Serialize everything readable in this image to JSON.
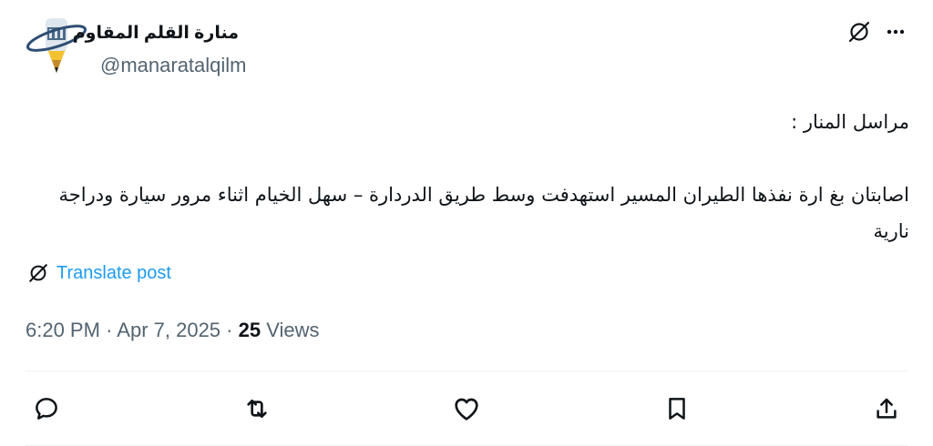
{
  "author": {
    "display_name": "منارة القلم المقاوم",
    "handle": "@manaratalqilm"
  },
  "tweet": {
    "lines": [
      "مراسل المنار :",
      "اصابتان بغ ارة نفذها الطيران المسير استهدفت وسط طريق الدردارة – سهل الخيام اثناء مرور سيارة ودراجة نارية"
    ]
  },
  "translate": {
    "label": "Translate post"
  },
  "meta": {
    "time": "6:20 PM",
    "sep1": "·",
    "date": "Apr 7, 2025",
    "sep2": "·",
    "views_count": "25",
    "views_label": "Views"
  },
  "icons": {
    "grok": "grok-icon",
    "more": "more-icon",
    "reply": "reply-icon",
    "repost": "repost-icon",
    "like": "like-icon",
    "bookmark": "bookmark-icon",
    "share": "share-icon",
    "translate": "translate-icon"
  },
  "colors": {
    "link": "#1d9bf0",
    "secondary": "#536471",
    "text": "#0f1419",
    "divider": "#eff3f4"
  }
}
